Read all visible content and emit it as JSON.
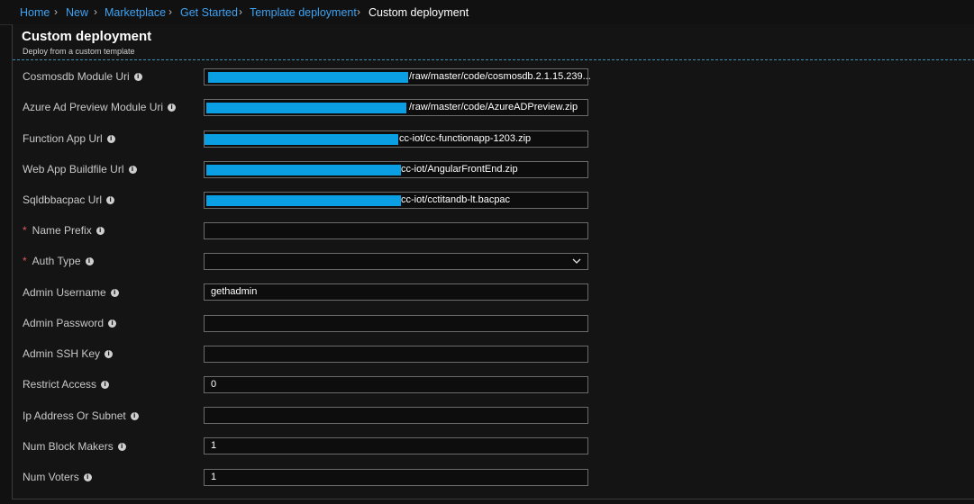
{
  "breadcrumb": {
    "items": [
      "Home",
      "New",
      "Marketplace",
      "Get Started",
      "Template deployment",
      "Custom deployment"
    ]
  },
  "header": {
    "title": "Custom deployment",
    "subtitle": "Deploy from a custom template"
  },
  "form": {
    "fields": [
      {
        "label": "Cosmosdb Module Uri",
        "value": "/raw/master/code/cosmosdb.2.1.15.239...",
        "required": false
      },
      {
        "label": "Azure Ad Preview Module Uri",
        "value": "/raw/master/code/AzureADPreview.zip",
        "required": false
      },
      {
        "label": "Function App Url",
        "value": "cc-iot/cc-functionapp-1203.zip",
        "required": false
      },
      {
        "label": "Web App Buildfile Url",
        "value": "cc-iot/AngularFrontEnd.zip",
        "required": false
      },
      {
        "label": "Sqldbbacpac Url",
        "value": "cc-iot/cctitandb-lt.bacpac",
        "required": false
      },
      {
        "label": "Name Prefix",
        "value": "",
        "required": true
      },
      {
        "label": "Auth Type",
        "value": "",
        "required": true,
        "type": "dropdown"
      },
      {
        "label": "Admin Username",
        "value": "gethadmin",
        "required": false
      },
      {
        "label": "Admin Password",
        "value": "",
        "required": false
      },
      {
        "label": "Admin SSH Key",
        "value": "",
        "required": false
      },
      {
        "label": "Restrict Access",
        "value": "0",
        "required": false
      },
      {
        "label": "Ip Address Or Subnet",
        "value": "",
        "required": false
      },
      {
        "label": "Num Block Makers",
        "value": "1",
        "required": false
      },
      {
        "label": "Num Voters",
        "value": "1",
        "required": false
      }
    ],
    "required_marker": "*",
    "info_icon": "i"
  },
  "colors": {
    "link": "#3ea2f2",
    "redaction": "#0a9ee3",
    "required": "#e05a5a"
  }
}
